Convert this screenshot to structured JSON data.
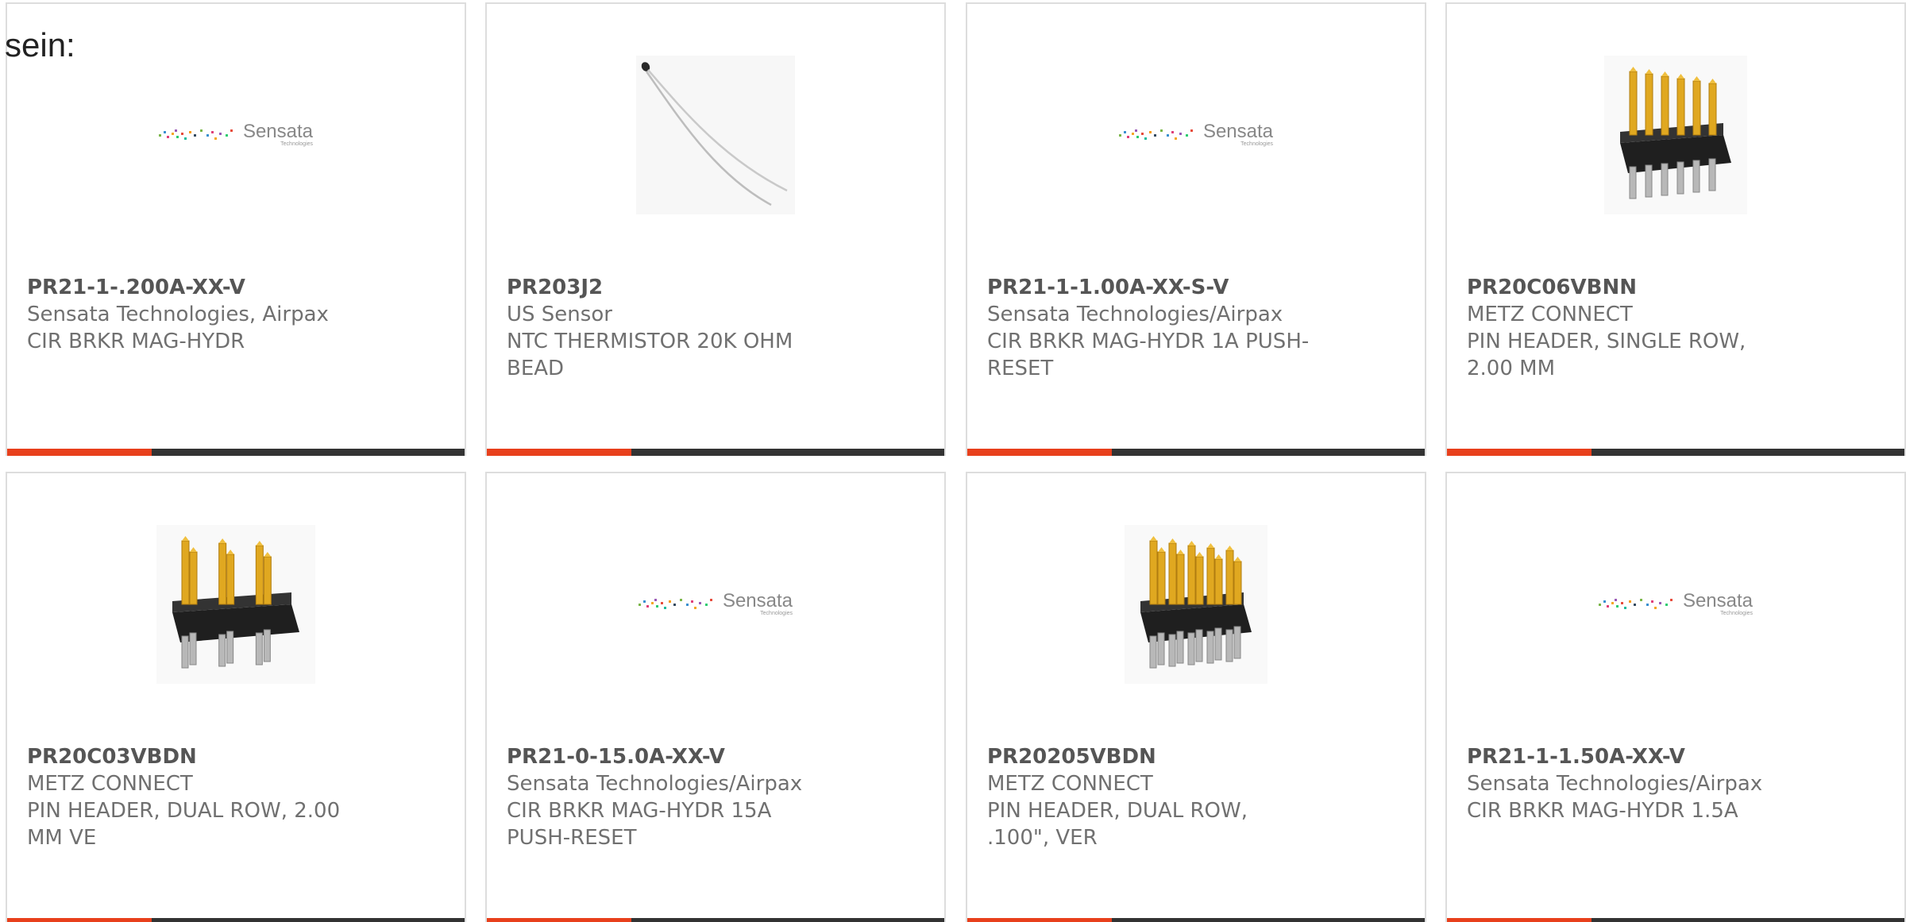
{
  "intro_text": "sein:",
  "colors": {
    "accent": "#e8401c",
    "bar": "#333333",
    "border": "#dddddd",
    "text": "#707070"
  },
  "products": [
    {
      "part": "PR21-1-.200A-XX-V",
      "manufacturer": "Sensata Technologies, Airpax",
      "description": "CIR BRKR MAG-HYDR",
      "image": "sensata-logo"
    },
    {
      "part": "PR203J2",
      "manufacturer": "US Sensor",
      "description": "NTC THERMISTOR 20K OHM BEAD",
      "image": "thermistor-photo"
    },
    {
      "part": "PR21-1-1.00A-XX-S-V",
      "manufacturer": "Sensata Technologies/Airpax",
      "description": "CIR BRKR MAG-HYDR 1A PUSH-RESET",
      "image": "sensata-logo"
    },
    {
      "part": "PR20C06VBNN",
      "manufacturer": "METZ CONNECT",
      "description": "PIN HEADER, SINGLE ROW, 2.00 MM",
      "image": "single-row-pin-header-photo"
    },
    {
      "part": "PR20C03VBDN",
      "manufacturer": "METZ CONNECT",
      "description": "PIN HEADER, DUAL ROW, 2.00 MM VE",
      "image": "dual-row-pin-header-small-photo"
    },
    {
      "part": "PR21-0-15.0A-XX-V",
      "manufacturer": "Sensata Technologies/Airpax",
      "description": "CIR BRKR MAG-HYDR 15A PUSH-RESET",
      "image": "sensata-logo"
    },
    {
      "part": "PR20205VBDN",
      "manufacturer": "METZ CONNECT",
      "description": "PIN HEADER, DUAL ROW, .100\", VER",
      "image": "dual-row-pin-header-photo"
    },
    {
      "part": "PR21-1-1.50A-XX-V",
      "manufacturer": "Sensata Technologies/Airpax",
      "description": "CIR BRKR MAG-HYDR 1.5A",
      "image": "sensata-logo"
    }
  ],
  "sensata_logo": {
    "name": "Sensata",
    "sub": "Technologies"
  }
}
